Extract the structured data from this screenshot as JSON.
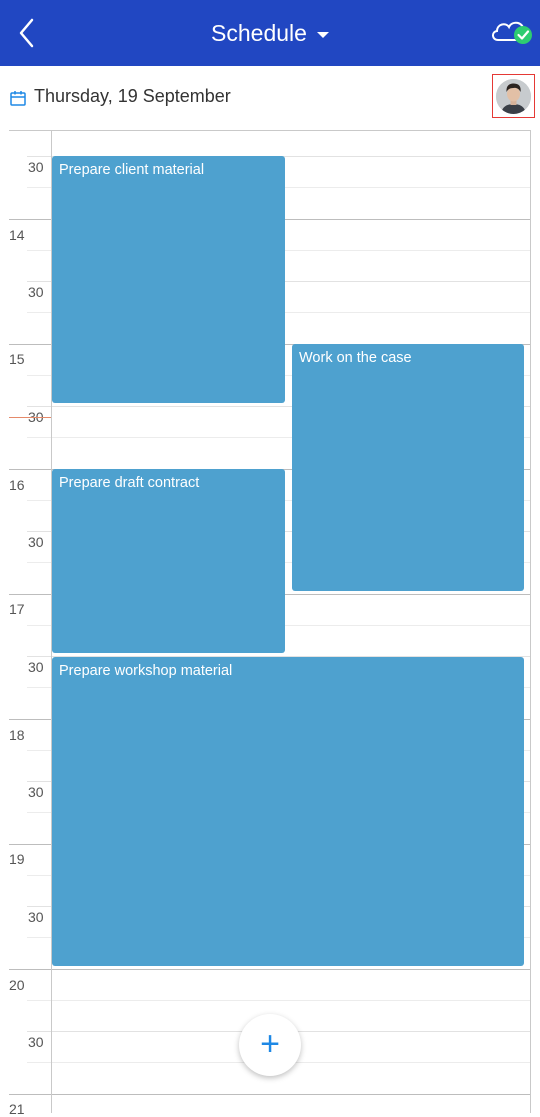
{
  "header": {
    "title": "Schedule"
  },
  "date_bar": {
    "date": "Thursday, 19 September"
  },
  "time_labels": [
    "30",
    "14",
    "30",
    "15",
    "30",
    "16",
    "30",
    "17",
    "30",
    "18",
    "30",
    "19",
    "30",
    "20",
    "30",
    "21"
  ],
  "events": [
    {
      "title": "Prepare client material"
    },
    {
      "title": "Work on the case"
    },
    {
      "title": "Prepare draft contract"
    },
    {
      "title": "Prepare workshop material"
    }
  ],
  "fab": {
    "label": "+"
  },
  "colors": {
    "header": "#2147c2",
    "event": "#4ea1cf",
    "now_line": "#e58a6a",
    "accent": "#1e88e5",
    "sync_ok": "#2ecc71"
  },
  "icons": {
    "back": "chevron-left-icon",
    "sync": "cloud-check-icon",
    "calendar": "calendar-icon",
    "add": "plus-icon"
  }
}
